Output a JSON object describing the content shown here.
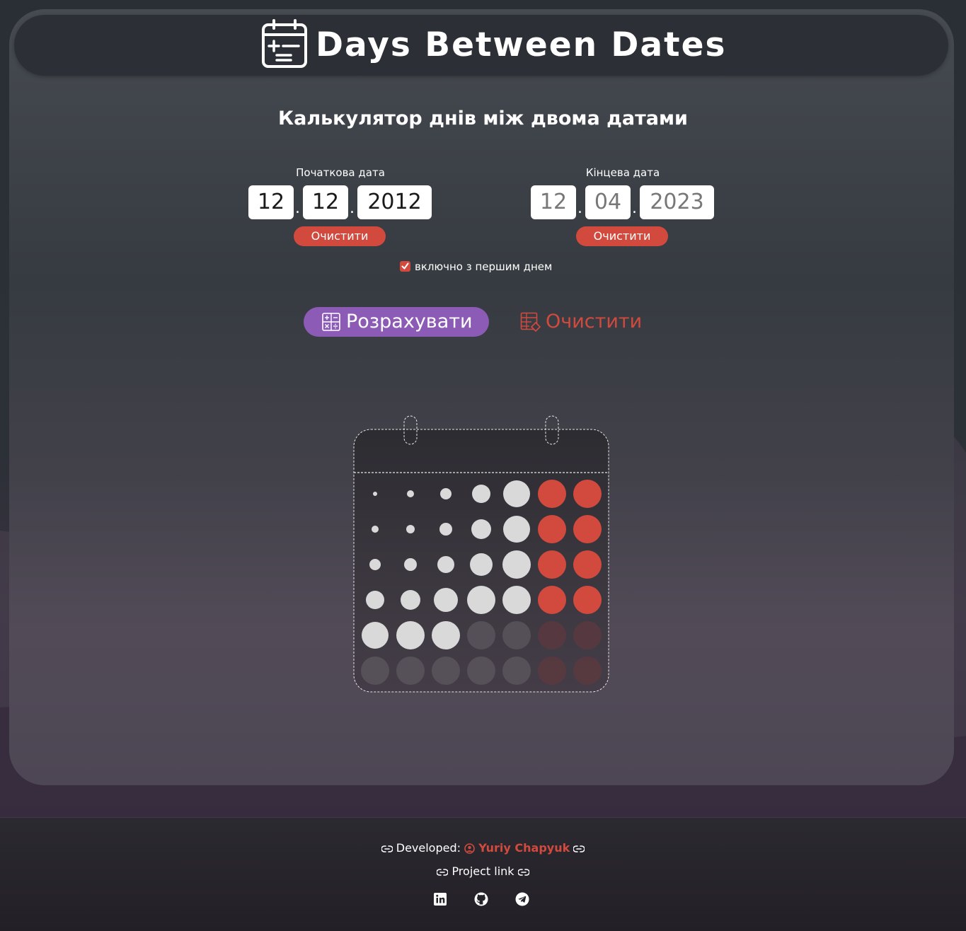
{
  "app": {
    "title": "Days Between Dates",
    "subtitle": "Калькулятор днів між двома датами"
  },
  "start_date": {
    "label": "Початкова дата",
    "day": "12",
    "month": "12",
    "year": "2012",
    "clear_label": "Очистити"
  },
  "end_date": {
    "label": "Кінцева дата",
    "day": "12",
    "month": "04",
    "year": "2023",
    "clear_label": "Очистити"
  },
  "separator": ".",
  "include_first_day": {
    "label": "включно з першим днем",
    "checked": true
  },
  "actions": {
    "calculate_label": "Розрахувати",
    "reset_label": "Очистити"
  },
  "footer": {
    "developed_label": "Developed:",
    "developer_name": "Yuriy Chapyuk",
    "project_link_label": "Project link",
    "social_icons": [
      "linkedin-icon",
      "github-icon",
      "telegram-icon"
    ]
  },
  "colors": {
    "accent_red": "#d24a3e",
    "accent_purple": "#8c5bb6",
    "dot_light": "#d9d9d9",
    "dot_dim": "#59555c"
  }
}
